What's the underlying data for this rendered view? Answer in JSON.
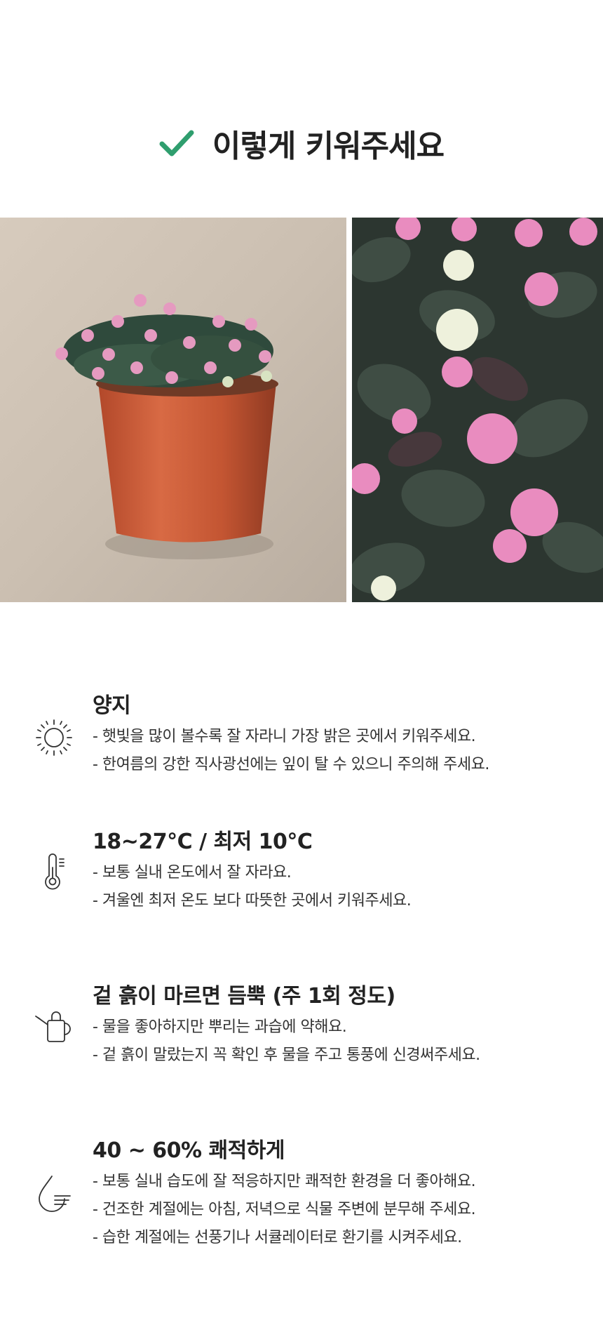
{
  "header": {
    "title": "이렇게 키워주세요",
    "accent_color": "#2f9e6e",
    "icon": "check-icon"
  },
  "photos": [
    {
      "name": "potted-plant-photo",
      "alt": ""
    },
    {
      "name": "flower-closeup-photo",
      "alt": ""
    }
  ],
  "tips": [
    {
      "icon": "sun-icon",
      "title": "양지",
      "lines": [
        "- 햇빛을 많이 볼수록 잘 자라니 가장 밝은 곳에서 키워주세요.",
        "- 한여름의 강한 직사광선에는 잎이 탈 수 있으니 주의해 주세요."
      ]
    },
    {
      "icon": "thermometer-icon",
      "title": "18~27°C  /  최저 10°C",
      "lines": [
        "- 보통 실내 온도에서 잘 자라요.",
        "- 겨울엔 최저 온도 보다 따뜻한 곳에서 키워주세요."
      ]
    },
    {
      "icon": "watering-can-icon",
      "title": "겉 흙이 마르면 듬뿍 (주 1회 정도)",
      "lines": [
        "- 물을 좋아하지만 뿌리는 과습에 약해요.",
        "- 겉 흙이 말랐는지 꼭 확인 후 물을 주고 통풍에 신경써주세요."
      ]
    },
    {
      "icon": "humidity-icon",
      "title": "40 ~ 60% 쾌적하게",
      "lines": [
        "- 보통 실내 습도에 잘 적응하지만 쾌적한 환경을 더 좋아해요.",
        "- 건조한 계절에는 아침, 저녁으로 식물 주변에 분무해 주세요.",
        "- 습한 계절에는 선풍기나 서큘레이터로 환기를 시켜주세요."
      ]
    }
  ]
}
